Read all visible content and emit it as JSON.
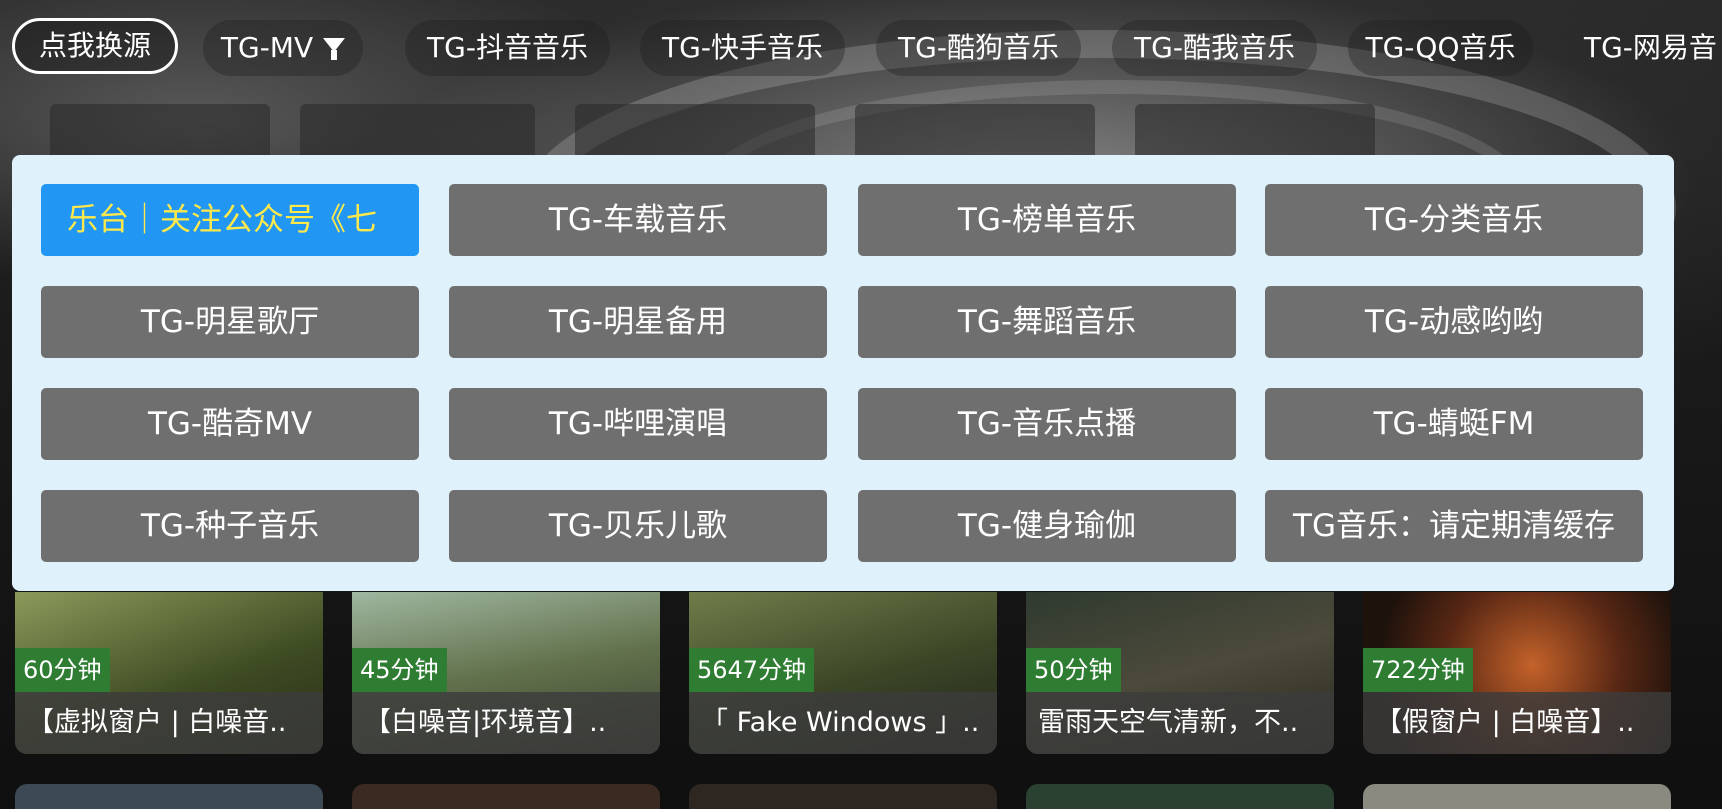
{
  "tabs": [
    {
      "label": "点我换源",
      "kind": "source"
    },
    {
      "label": "TG-MV",
      "kind": "filter"
    },
    {
      "label": "TG-抖音音乐"
    },
    {
      "label": "TG-快手音乐"
    },
    {
      "label": "TG-酷狗音乐"
    },
    {
      "label": "TG-酷我音乐"
    },
    {
      "label": "TG-QQ音乐"
    },
    {
      "label": "TG-网易音"
    }
  ],
  "source_panel": {
    "options": [
      "乐台｜关注公众号《七",
      "TG-车载音乐",
      "TG-榜单音乐",
      "TG-分类音乐",
      "TG-明星歌厅",
      "TG-明星备用",
      "TG-舞蹈音乐",
      "TG-动感哟哟",
      "TG-酷奇MV",
      "TG-哔哩演唱",
      "TG-音乐点播",
      "TG-蜻蜓FM",
      "TG-种子音乐",
      "TG-贝乐儿歌",
      "TG-健身瑜伽",
      "TG音乐：请定期清缓存"
    ],
    "selected_index": 0
  },
  "videos": [
    {
      "duration": "60分钟",
      "title": "【虚拟窗户 | 白噪音..",
      "thumb_color": "#5e6b3a"
    },
    {
      "duration": "45分钟",
      "title": "【白噪音|环境音】..",
      "thumb_color": "#6d7a5a"
    },
    {
      "duration": "5647分钟",
      "title": "「 Fake Windows 」..",
      "thumb_color": "#3f4a2c"
    },
    {
      "duration": "50分钟",
      "title": "雷雨天空气清新，不..",
      "thumb_color": "#3a3a32"
    },
    {
      "duration": "722分钟",
      "title": "【假窗户 | 白噪音】..",
      "thumb_color": "#4a2a1a"
    }
  ],
  "colors": {
    "panel_bg": "#dff1fb",
    "option_bg": "#6f6f6f",
    "selected_bg": "#2196f3",
    "selected_text": "#ffe94a",
    "duration_badge": "#2e7d32"
  }
}
